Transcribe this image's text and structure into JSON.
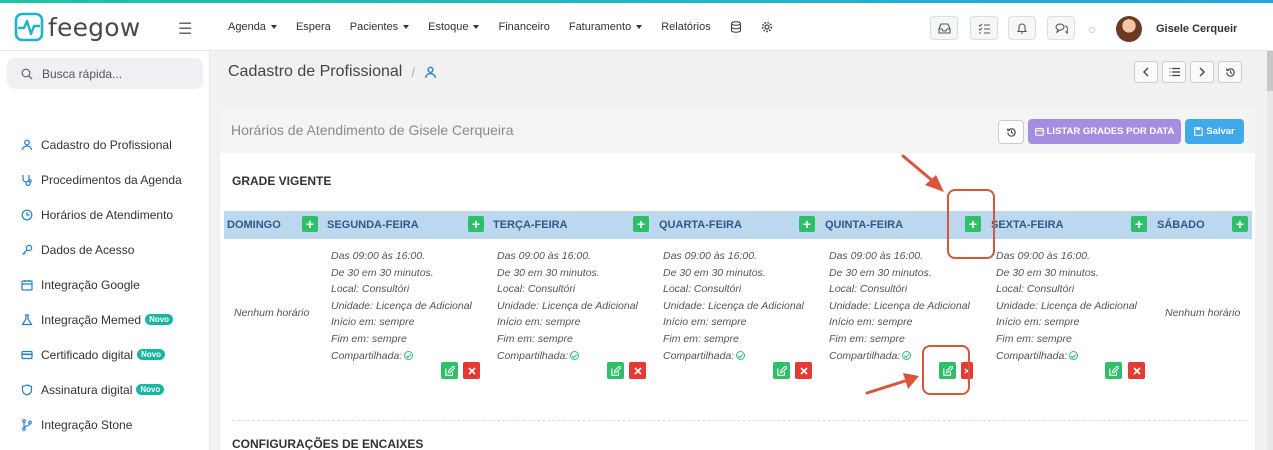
{
  "brand": {
    "name": "feegow"
  },
  "header": {
    "menu": [
      {
        "label": "Agenda",
        "dropdown": true
      },
      {
        "label": "Espera",
        "dropdown": false
      },
      {
        "label": "Pacientes",
        "dropdown": true
      },
      {
        "label": "Estoque",
        "dropdown": true
      },
      {
        "label": "Financeiro",
        "dropdown": false
      },
      {
        "label": "Faturamento",
        "dropdown": true
      },
      {
        "label": "Relatórios",
        "dropdown": false
      }
    ],
    "user_name": "Gisele Cerqueir"
  },
  "sidebar": {
    "search_placeholder": "Busca rápida...",
    "badge": "Novo",
    "items": [
      {
        "label": "Cadastro do Profissional"
      },
      {
        "label": "Procedimentos da Agenda"
      },
      {
        "label": "Horários de Atendimento"
      },
      {
        "label": "Dados de Acesso"
      },
      {
        "label": "Integração Google"
      },
      {
        "label": "Integração Memed",
        "badge": "Novo"
      },
      {
        "label": "Certificado digital",
        "badge": "Novo"
      },
      {
        "label": "Assinatura digital",
        "badge": "Novo"
      },
      {
        "label": "Integração Stone"
      }
    ]
  },
  "page": {
    "title": "Cadastro de Profissional",
    "separator": "/"
  },
  "card": {
    "title": "Horários de Atendimento de Gisele Cerqueira",
    "list_button": "LISTAR GRADES POR DATA",
    "save_button": "Salvar"
  },
  "grade": {
    "title": "GRADE VIGENTE",
    "days": [
      "DOMINGO",
      "SEGUNDA-FEIRA",
      "TERÇA-FEIRA",
      "QUARTA-FEIRA",
      "QUINTA-FEIRA",
      "SEXTA-FEIRA",
      "SÁBADO"
    ],
    "none_text": "Nenhum horário",
    "schedule": [
      "Das 09:00 às 16:00.",
      "De 30 em 30 minutos.",
      "Local: Consultóri",
      "Unidade: Licença de Adicional",
      "Início em: sempre",
      "Fim em: sempre",
      "Compartilhada:"
    ]
  },
  "encaixes": {
    "title": "CONFIGURAÇÕES DE ENCAIXES"
  },
  "colors": {
    "accent_green": "#2ebf68",
    "delete_red": "#e53935",
    "day_bar": "#bcd8ef",
    "purple_button": "#a58de0",
    "blue_button": "#3fa9ea",
    "annotation": "#d9553c"
  }
}
